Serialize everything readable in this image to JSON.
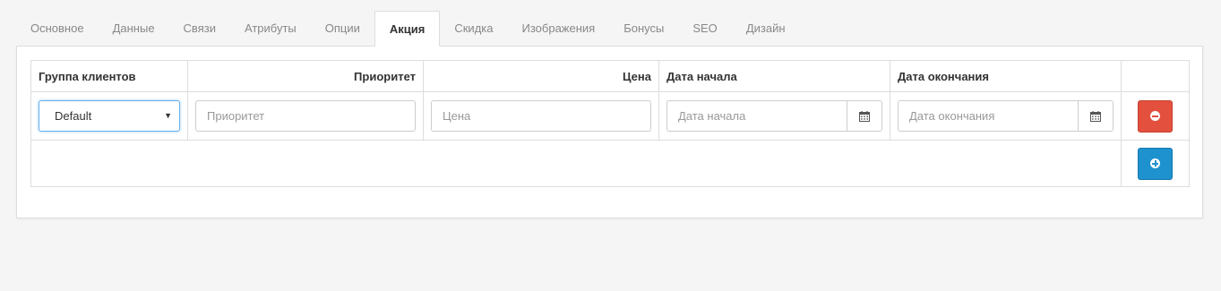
{
  "tabs": [
    {
      "label": "Основное",
      "active": false
    },
    {
      "label": "Данные",
      "active": false
    },
    {
      "label": "Связи",
      "active": false
    },
    {
      "label": "Атрибуты",
      "active": false
    },
    {
      "label": "Опции",
      "active": false
    },
    {
      "label": "Акция",
      "active": true
    },
    {
      "label": "Скидка",
      "active": false
    },
    {
      "label": "Изображения",
      "active": false
    },
    {
      "label": "Бонусы",
      "active": false
    },
    {
      "label": "SEO",
      "active": false
    },
    {
      "label": "Дизайн",
      "active": false
    }
  ],
  "table": {
    "headers": {
      "customer_group": "Группа клиентов",
      "priority": "Приоритет",
      "price": "Цена",
      "date_start": "Дата начала",
      "date_end": "Дата окончания"
    },
    "row": {
      "customer_group_value": "Default",
      "priority_placeholder": "Приоритет",
      "price_placeholder": "Цена",
      "date_start_placeholder": "Дата начала",
      "date_end_placeholder": "Дата окончания"
    }
  },
  "icons": {
    "calendar": "calendar-icon",
    "remove": "minus-circle-icon",
    "add": "plus-circle-icon",
    "caret": "caret-down-icon"
  },
  "colors": {
    "remove_button": "#e3503e",
    "add_button": "#1e91cf",
    "focus_border": "#66afe9"
  }
}
